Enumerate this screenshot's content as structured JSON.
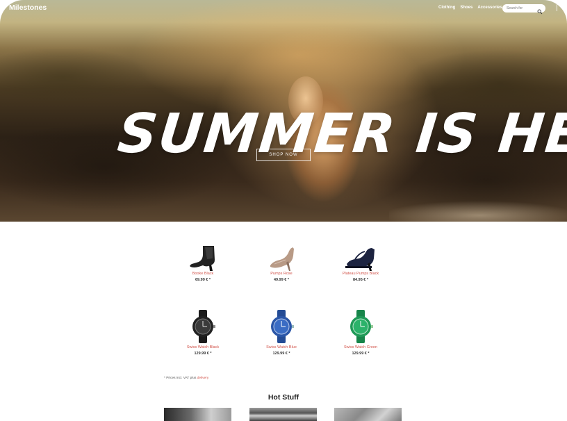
{
  "brand": {
    "logo_text": "Milestones"
  },
  "nav": {
    "links": [
      "Clothing",
      "Shoes",
      "Accessories"
    ],
    "search_placeholder": "Search for"
  },
  "hero": {
    "headline": "Summer is here",
    "cta_label": "Shop Now"
  },
  "products": [
    {
      "name": "Booke Black",
      "price": "69.99 € *",
      "icon": "ankle-boot-icon",
      "color": "#222222"
    },
    {
      "name": "Pumps Rose",
      "price": "49.99 € *",
      "icon": "high-heel-pump-icon",
      "color": "#b89a86"
    },
    {
      "name": "Plateau Pumps Black",
      "price": "84.95 € *",
      "icon": "strap-pump-icon",
      "color": "#1c2340"
    },
    {
      "name": "Swiss Watch Black",
      "price": "129.99 € *",
      "icon": "watch-icon",
      "color": "#222222"
    },
    {
      "name": "Swiss Watch Blue",
      "price": "129.99 € *",
      "icon": "watch-icon",
      "color": "#2a56a8"
    },
    {
      "name": "Swiss Watch Green",
      "price": "129.99 € *",
      "icon": "watch-icon",
      "color": "#1f9a57"
    }
  ],
  "footnote": {
    "text": "* Prices incl. VAT plus ",
    "link": "delivery"
  },
  "section": {
    "title": "Hot Stuff"
  },
  "colors": {
    "accent": "#d2544b",
    "text_dark": "#333333",
    "hero_cta_border": "#ffffff"
  }
}
